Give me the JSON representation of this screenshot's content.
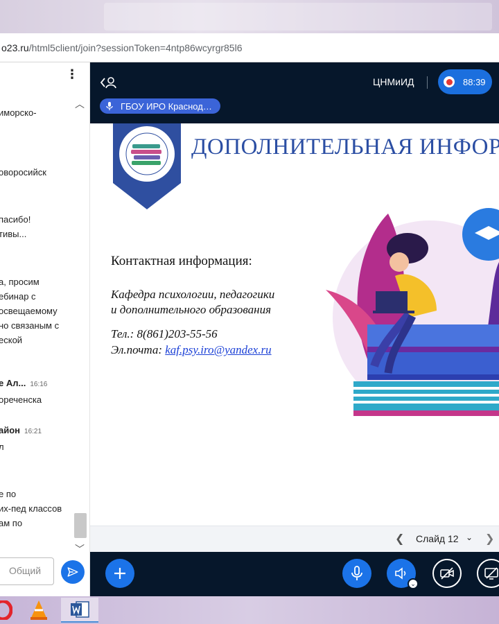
{
  "browser": {
    "url_host": "o23.ru",
    "url_path": "/html5client/join?sessionToken=4ntp86wcyrgr85l6"
  },
  "chat": {
    "messages": [
      {
        "text": "иморско-"
      },
      {
        "text": "оворосийск"
      },
      {
        "text": "пасибо!"
      },
      {
        "text": "тивы..."
      },
      {
        "text": "а, просим"
      },
      {
        "text": "ебинар с"
      },
      {
        "text": "освещаемому"
      },
      {
        "text": "но связаным с"
      },
      {
        "text": "еской"
      },
      {
        "name": "е Ал...",
        "time": "16:16"
      },
      {
        "text": "ореченска"
      },
      {
        "name": "айон",
        "time": "16:21"
      },
      {
        "text": "л"
      },
      {
        "text": "е по"
      },
      {
        "text": "их-пед классов"
      },
      {
        "text": "ам по"
      }
    ],
    "input_placeholder": "Общий"
  },
  "meeting": {
    "room_name": "ЦНМиИД",
    "timer": "88:39",
    "talker": "ГБОУ ИРО Краснод…"
  },
  "slide": {
    "title": "ДОПОЛНИТЕЛЬНАЯ ИНФОРМ",
    "contact_heading": "Контактная информация:",
    "dept_line1": "Кафедра  психологии,  педагогики",
    "dept_line2": "и дополнительного образования",
    "tel": "Тел.: 8(861)203-55-56",
    "email_label": "Эл.почта: ",
    "email": "kaf.psy.iro@yandex.ru"
  },
  "slide_nav": {
    "label": "Слайд 12"
  },
  "colors": {
    "accent": "#1b73e8",
    "dark_bg": "#06172b",
    "title_blue": "#2b4ea3",
    "record_red": "#e53935"
  }
}
